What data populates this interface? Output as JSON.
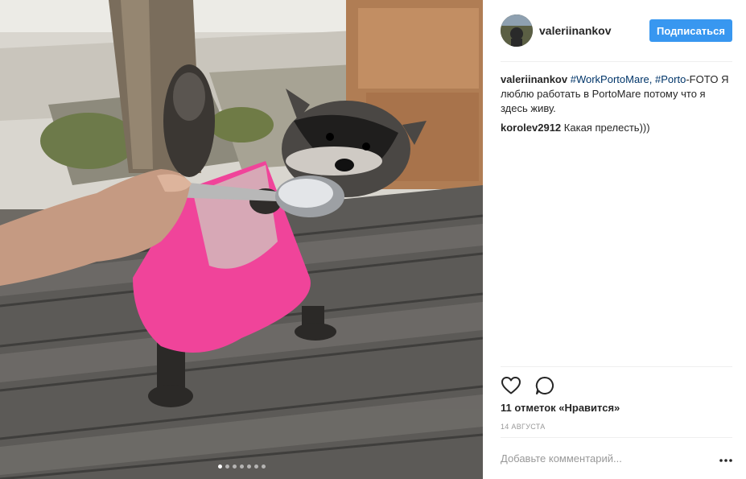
{
  "post": {
    "username": "valeriinankov",
    "follow_label": "Подписаться",
    "caption": {
      "author": "valeriinankov",
      "tag1": "#WorkPortoMare,",
      "tag2": "#Porto",
      "text_after_tag": "-FOTO Я люблю работать в PortoMare потому что я здесь живу."
    },
    "comments": [
      {
        "author": "korolev2912",
        "text": "Какая прелесть)))"
      }
    ],
    "likes": "11 отметок «Нравится»",
    "date": "14 августа",
    "add_comment_placeholder": "Добавьте комментарий...",
    "carousel": {
      "count": 7,
      "active_index": 0
    }
  },
  "icons": {
    "like": "heart-icon",
    "comment": "speech-bubble-icon",
    "more": "more-options-icon"
  },
  "colors": {
    "follow_button": "#3897f0",
    "hashtag": "#003569",
    "muted_text": "#999999"
  }
}
